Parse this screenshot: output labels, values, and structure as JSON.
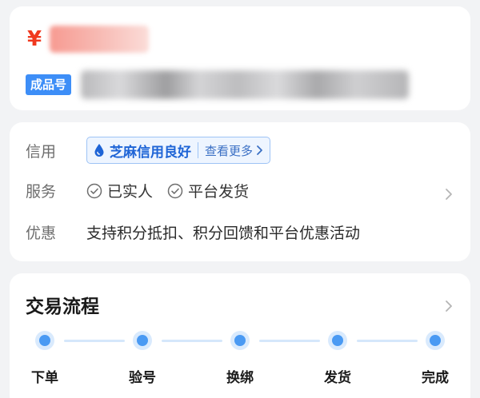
{
  "price": {
    "currency_symbol": "¥"
  },
  "product": {
    "badge": "成品号"
  },
  "info": {
    "credit_label": "信用",
    "credit_tag": "芝麻信用良好",
    "credit_more": "查看更多",
    "service_label": "服务",
    "services": [
      "已实人",
      "平台发货"
    ],
    "discount_label": "优惠",
    "discount_text": "支持积分抵扣、积分回馈和平台优惠活动"
  },
  "flow": {
    "title": "交易流程",
    "steps": [
      "下单",
      "验号",
      "换绑",
      "发货",
      "完成"
    ]
  },
  "colors": {
    "accent_blue": "#4a9af3",
    "price_red": "#f0391f",
    "badge_blue": "#3d8ef7"
  }
}
